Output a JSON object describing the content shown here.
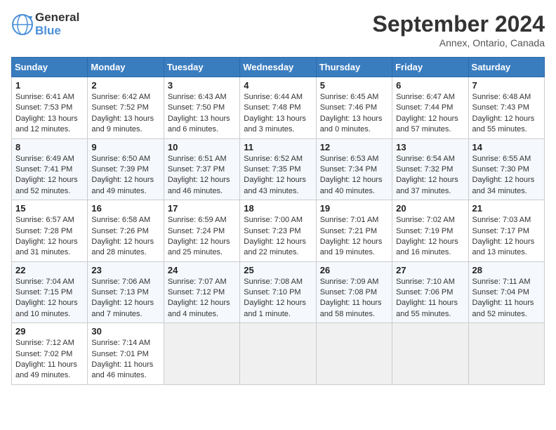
{
  "header": {
    "logo_line1": "General",
    "logo_line2": "Blue",
    "month": "September 2024",
    "location": "Annex, Ontario, Canada"
  },
  "days_of_week": [
    "Sunday",
    "Monday",
    "Tuesday",
    "Wednesday",
    "Thursday",
    "Friday",
    "Saturday"
  ],
  "weeks": [
    [
      {
        "day": "1",
        "sunrise": "6:41 AM",
        "sunset": "7:53 PM",
        "daylight": "13 hours and 12 minutes."
      },
      {
        "day": "2",
        "sunrise": "6:42 AM",
        "sunset": "7:52 PM",
        "daylight": "13 hours and 9 minutes."
      },
      {
        "day": "3",
        "sunrise": "6:43 AM",
        "sunset": "7:50 PM",
        "daylight": "13 hours and 6 minutes."
      },
      {
        "day": "4",
        "sunrise": "6:44 AM",
        "sunset": "7:48 PM",
        "daylight": "13 hours and 3 minutes."
      },
      {
        "day": "5",
        "sunrise": "6:45 AM",
        "sunset": "7:46 PM",
        "daylight": "13 hours and 0 minutes."
      },
      {
        "day": "6",
        "sunrise": "6:47 AM",
        "sunset": "7:44 PM",
        "daylight": "12 hours and 57 minutes."
      },
      {
        "day": "7",
        "sunrise": "6:48 AM",
        "sunset": "7:43 PM",
        "daylight": "12 hours and 55 minutes."
      }
    ],
    [
      {
        "day": "8",
        "sunrise": "6:49 AM",
        "sunset": "7:41 PM",
        "daylight": "12 hours and 52 minutes."
      },
      {
        "day": "9",
        "sunrise": "6:50 AM",
        "sunset": "7:39 PM",
        "daylight": "12 hours and 49 minutes."
      },
      {
        "day": "10",
        "sunrise": "6:51 AM",
        "sunset": "7:37 PM",
        "daylight": "12 hours and 46 minutes."
      },
      {
        "day": "11",
        "sunrise": "6:52 AM",
        "sunset": "7:35 PM",
        "daylight": "12 hours and 43 minutes."
      },
      {
        "day": "12",
        "sunrise": "6:53 AM",
        "sunset": "7:34 PM",
        "daylight": "12 hours and 40 minutes."
      },
      {
        "day": "13",
        "sunrise": "6:54 AM",
        "sunset": "7:32 PM",
        "daylight": "12 hours and 37 minutes."
      },
      {
        "day": "14",
        "sunrise": "6:55 AM",
        "sunset": "7:30 PM",
        "daylight": "12 hours and 34 minutes."
      }
    ],
    [
      {
        "day": "15",
        "sunrise": "6:57 AM",
        "sunset": "7:28 PM",
        "daylight": "12 hours and 31 minutes."
      },
      {
        "day": "16",
        "sunrise": "6:58 AM",
        "sunset": "7:26 PM",
        "daylight": "12 hours and 28 minutes."
      },
      {
        "day": "17",
        "sunrise": "6:59 AM",
        "sunset": "7:24 PM",
        "daylight": "12 hours and 25 minutes."
      },
      {
        "day": "18",
        "sunrise": "7:00 AM",
        "sunset": "7:23 PM",
        "daylight": "12 hours and 22 minutes."
      },
      {
        "day": "19",
        "sunrise": "7:01 AM",
        "sunset": "7:21 PM",
        "daylight": "12 hours and 19 minutes."
      },
      {
        "day": "20",
        "sunrise": "7:02 AM",
        "sunset": "7:19 PM",
        "daylight": "12 hours and 16 minutes."
      },
      {
        "day": "21",
        "sunrise": "7:03 AM",
        "sunset": "7:17 PM",
        "daylight": "12 hours and 13 minutes."
      }
    ],
    [
      {
        "day": "22",
        "sunrise": "7:04 AM",
        "sunset": "7:15 PM",
        "daylight": "12 hours and 10 minutes."
      },
      {
        "day": "23",
        "sunrise": "7:06 AM",
        "sunset": "7:13 PM",
        "daylight": "12 hours and 7 minutes."
      },
      {
        "day": "24",
        "sunrise": "7:07 AM",
        "sunset": "7:12 PM",
        "daylight": "12 hours and 4 minutes."
      },
      {
        "day": "25",
        "sunrise": "7:08 AM",
        "sunset": "7:10 PM",
        "daylight": "12 hours and 1 minute."
      },
      {
        "day": "26",
        "sunrise": "7:09 AM",
        "sunset": "7:08 PM",
        "daylight": "11 hours and 58 minutes."
      },
      {
        "day": "27",
        "sunrise": "7:10 AM",
        "sunset": "7:06 PM",
        "daylight": "11 hours and 55 minutes."
      },
      {
        "day": "28",
        "sunrise": "7:11 AM",
        "sunset": "7:04 PM",
        "daylight": "11 hours and 52 minutes."
      }
    ],
    [
      {
        "day": "29",
        "sunrise": "7:12 AM",
        "sunset": "7:02 PM",
        "daylight": "11 hours and 49 minutes."
      },
      {
        "day": "30",
        "sunrise": "7:14 AM",
        "sunset": "7:01 PM",
        "daylight": "11 hours and 46 minutes."
      },
      null,
      null,
      null,
      null,
      null
    ]
  ]
}
